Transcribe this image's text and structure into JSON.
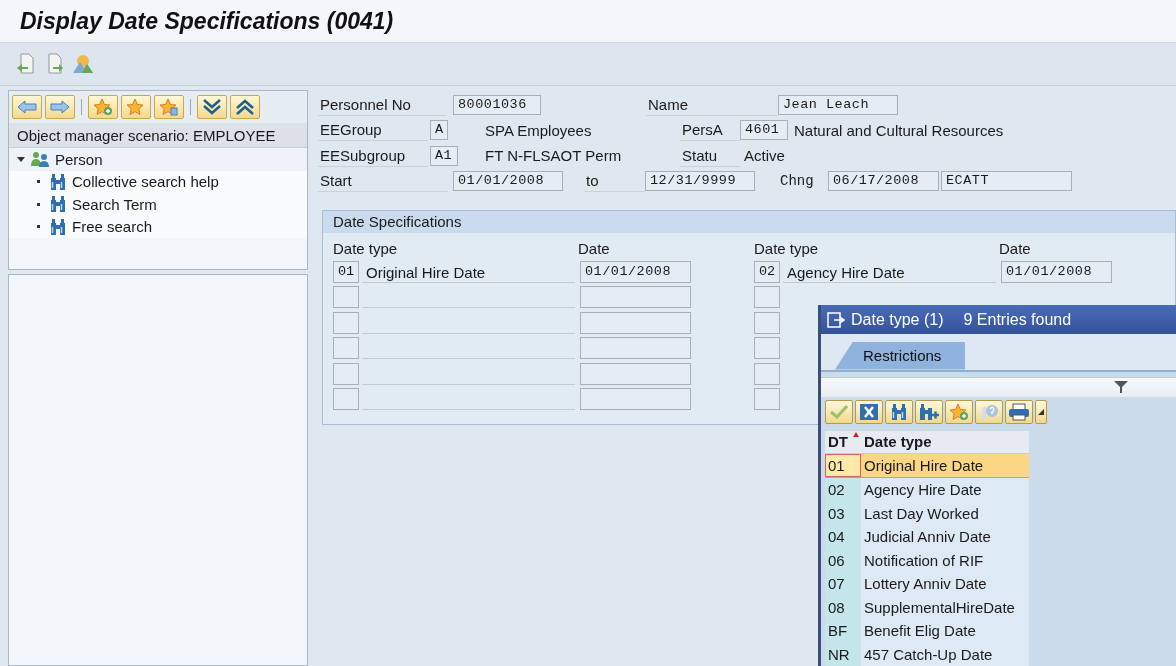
{
  "window": {
    "title": "Display Date Specifications (0041)"
  },
  "navigator": {
    "header": "Object manager scenario: EMPLOYEE",
    "tree": [
      {
        "label": "Person",
        "expanded": true,
        "children": [
          {
            "label": "Collective search help"
          },
          {
            "label": "Search Term"
          },
          {
            "label": "Free search"
          }
        ]
      }
    ]
  },
  "header": {
    "personnel_no": {
      "label": "Personnel No",
      "value": "80001036"
    },
    "name": {
      "label": "Name",
      "value": "Jean Leach"
    },
    "ee_group": {
      "label": "EEGroup",
      "code": "A",
      "text": "SPA Employees"
    },
    "pers_area": {
      "label": "PersA",
      "code": "4601",
      "text": "Natural and Cultural Resources"
    },
    "ee_subgroup": {
      "label": "EESubgroup",
      "code": "A1",
      "text": "FT N-FLSAOT Perm"
    },
    "status": {
      "label": "Statu",
      "text": "Active"
    },
    "start": {
      "label": "Start",
      "value": "01/01/2008"
    },
    "end": {
      "label": "to",
      "value": "12/31/9999"
    },
    "changed": {
      "label": "Chng",
      "date": "06/17/2008",
      "user": "ECATT"
    }
  },
  "date_specifications": {
    "title": "Date Specifications",
    "left": {
      "columns": [
        "Date type",
        "Date"
      ],
      "rows": [
        {
          "code": "01",
          "text": "Original Hire Date",
          "date": "01/01/2008"
        },
        {},
        {},
        {},
        {},
        {}
      ]
    },
    "right": {
      "columns": [
        "Date type",
        "Date"
      ],
      "rows": [
        {
          "code": "02",
          "text": "Agency Hire Date",
          "date": "01/01/2008"
        },
        {},
        {},
        {},
        {},
        {}
      ]
    }
  },
  "popup": {
    "title": "Date type (1)",
    "count": "9 Entries found",
    "tabs": [
      {
        "label": "Restrictions",
        "selected": true
      }
    ],
    "columns": [
      "DT",
      "Date type"
    ],
    "rows": [
      {
        "code": "01",
        "text": "Original Hire Date",
        "selected": true
      },
      {
        "code": "02",
        "text": "Agency Hire Date",
        "selected": false
      },
      {
        "code": "03",
        "text": "Last Day Worked",
        "selected": false
      },
      {
        "code": "04",
        "text": "Judicial Anniv Date",
        "selected": false
      },
      {
        "code": "06",
        "text": "Notification of RIF",
        "selected": false
      },
      {
        "code": "07",
        "text": "Lottery Anniv Date",
        "selected": false
      },
      {
        "code": "08",
        "text": "SupplementalHireDate",
        "selected": false
      },
      {
        "code": "BF",
        "text": "Benefit Elig Date",
        "selected": false
      },
      {
        "code": "NR",
        "text": "457 Catch-Up Date",
        "selected": false
      }
    ]
  }
}
